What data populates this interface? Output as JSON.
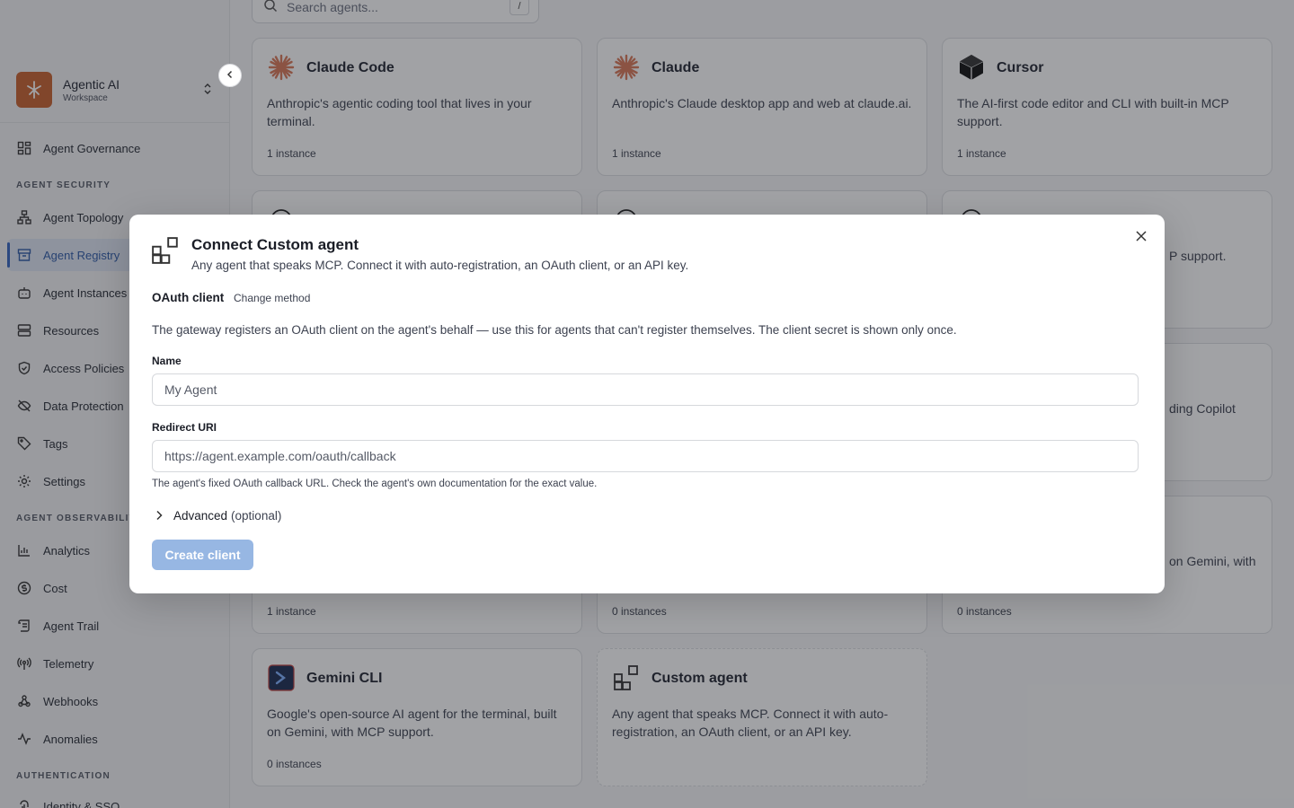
{
  "search": {
    "placeholder": "Search agents...",
    "shortcut": "/"
  },
  "workspace": {
    "name": "Agentic AI",
    "subtitle": "Workspace"
  },
  "sidebar": {
    "top_item": {
      "label": "Agent Governance",
      "icon": "grid-icon"
    },
    "sections": [
      {
        "title": "AGENT SECURITY"
      },
      {
        "title": "AGENT OBSERVABILITY"
      },
      {
        "title": "AUTHENTICATION"
      }
    ],
    "security_items": [
      {
        "label": "Agent Topology",
        "icon": "topology-icon"
      },
      {
        "label": "Agent Registry",
        "icon": "archive-icon",
        "active": true
      },
      {
        "label": "Agent Instances",
        "icon": "bot-icon"
      },
      {
        "label": "Resources",
        "icon": "server-icon"
      },
      {
        "label": "Access Policies",
        "icon": "shield-icon"
      },
      {
        "label": "Data Protection",
        "icon": "eye-off-icon"
      },
      {
        "label": "Tags",
        "icon": "tag-icon"
      },
      {
        "label": "Settings",
        "icon": "gear-icon"
      }
    ],
    "observability_items": [
      {
        "label": "Analytics",
        "icon": "bar-chart-icon"
      },
      {
        "label": "Cost",
        "icon": "dollar-icon"
      },
      {
        "label": "Agent Trail",
        "icon": "scroll-icon"
      },
      {
        "label": "Telemetry",
        "icon": "radio-icon"
      },
      {
        "label": "Webhooks",
        "icon": "webhook-icon"
      },
      {
        "label": "Anomalies",
        "icon": "activity-icon"
      }
    ],
    "auth_items": [
      {
        "label": "Identity & SSO",
        "icon": "fingerprint-icon"
      }
    ]
  },
  "cards": [
    {
      "title": "Claude Code",
      "desc": "Anthropic's agentic coding tool that lives in your terminal.",
      "count": "1 instance",
      "icon": "claude-icon"
    },
    {
      "title": "Claude",
      "desc": "Anthropic's Claude desktop app and web at claude.ai.",
      "count": "1 instance",
      "icon": "claude-icon"
    },
    {
      "title": "Cursor",
      "desc": "The AI-first code editor and CLI with built-in MCP support.",
      "count": "1 instance",
      "icon": "cursor-icon"
    },
    {
      "desc": "P support."
    },
    {
      "desc": "ding Copilot"
    },
    {
      "desc": "on Gemini, with"
    },
    {
      "count": "1 instance"
    },
    {
      "count": "0 instances"
    },
    {
      "count": "0 instances"
    },
    {
      "title": "Gemini CLI",
      "desc": "Google's open-source AI agent for the terminal, built on Gemini, with MCP support.",
      "count": "0 instances",
      "icon": "gemini-cli-icon"
    },
    {
      "title": "Custom agent",
      "desc": "Any agent that speaks MCP. Connect it with auto-registration, an OAuth client, or an API key.",
      "icon": "custom-agent-icon"
    }
  ],
  "modal": {
    "title": "Connect Custom agent",
    "subtitle": "Any agent that speaks MCP. Connect it with auto-registration, an OAuth client, or an API key.",
    "method": "OAuth client",
    "change_method": "Change method",
    "description": "The gateway registers an OAuth client on the agent's behalf — use this for agents that can't register themselves. The client secret is shown only once.",
    "name_label": "Name",
    "name_placeholder": "My Agent",
    "redirect_label": "Redirect URI",
    "redirect_placeholder": "https://agent.example.com/oauth/callback",
    "redirect_help": "The agent's fixed OAuth callback URL. Check the agent's own documentation for the exact value.",
    "advanced_label": "Advanced",
    "advanced_hint": "(optional)",
    "submit_label": "Create client",
    "submit_color": "#97b7e3"
  },
  "colors": {
    "accent": "#3565c0",
    "brand": "#c8612e",
    "claude": "#d97757"
  }
}
